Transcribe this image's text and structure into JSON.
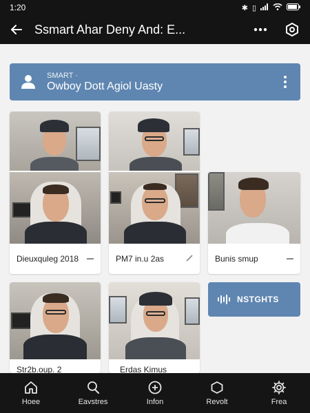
{
  "status_bar": {
    "time": "1:20",
    "icons": [
      "bluetooth-icon",
      "vibrate-icon",
      "signal-icon",
      "wifi-icon",
      "battery-icon"
    ]
  },
  "app_bar": {
    "title": "Ssmart Ahar Deny And: E...",
    "icons": [
      "back-arrow-icon",
      "more-dots-icon",
      "settings-hex-icon"
    ]
  },
  "banner": {
    "small_label": "SMART ·",
    "main_label": "Owboy Dott Agiol Uasty",
    "color": "#5f86b1"
  },
  "tiles": [
    {
      "caption": "Dieuxquleg 2018"
    },
    {
      "caption": "PM7 in.u 2as"
    },
    {
      "caption": "Bunis smup"
    },
    {
      "caption": "Str2b.oup. 2"
    },
    {
      "caption": "Erdas Kimus"
    }
  ],
  "insights": {
    "label": "NSTGHTS",
    "icon": "audio-wave-icon",
    "color": "#5f86b1"
  },
  "bottom_nav": {
    "items": [
      {
        "label": "Hoee",
        "icon": "home-icon"
      },
      {
        "label": "Eavstres",
        "icon": "search-icon"
      },
      {
        "label": "Infon",
        "icon": "add-circle-icon"
      },
      {
        "label": "Revolt",
        "icon": "hexagon-icon"
      },
      {
        "label": "Frea",
        "icon": "gear-icon"
      }
    ]
  }
}
